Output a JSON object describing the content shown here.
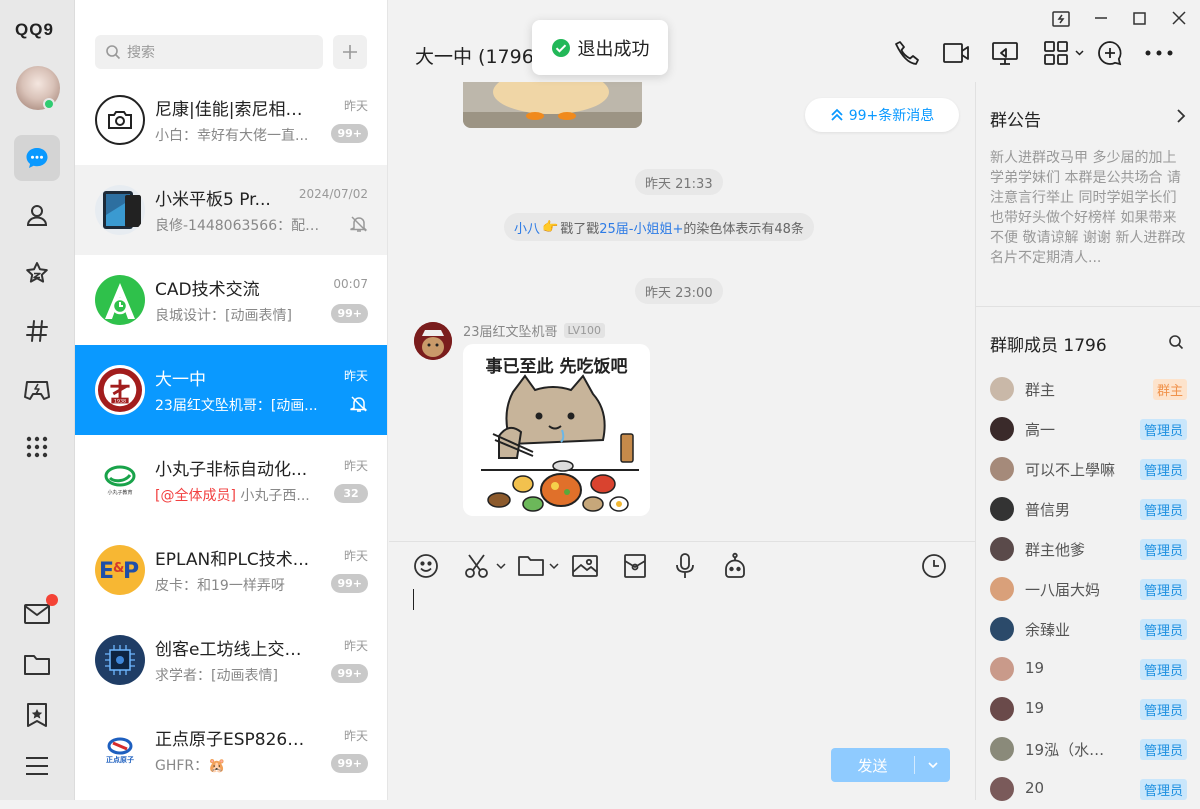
{
  "app": {
    "logo": "QQ9"
  },
  "sidebar": {
    "items": [
      {
        "name": "messages",
        "active": true
      },
      {
        "name": "contacts"
      },
      {
        "name": "zone"
      },
      {
        "name": "channels"
      },
      {
        "name": "games"
      },
      {
        "name": "apps"
      }
    ],
    "bottom": [
      "mail",
      "folder",
      "favorites",
      "menu"
    ]
  },
  "search": {
    "placeholder": "搜索"
  },
  "conversations": [
    {
      "name": "尼康|佳能|索尼相机...",
      "time": "昨天",
      "preview": "小白：幸好有大佬一直...",
      "badge": "99+"
    },
    {
      "name": "小米平板5 Pr...",
      "time": "2024/07/02",
      "preview": "良修-1448063566：配置...",
      "muted": true
    },
    {
      "name": "CAD技术交流",
      "time": "00:07",
      "preview": "良城设计：[动画表情]",
      "badge": "99+"
    },
    {
      "name": "大一中",
      "time": "昨天",
      "preview": "23届红文坠机哥：[动画...",
      "muted": true,
      "selected": true
    },
    {
      "name": "小丸子非标自动化...",
      "time": "昨天",
      "mention": "[@全体成员]",
      "preview": " 小丸子西...",
      "badge": "32"
    },
    {
      "name": "EPLAN和PLC技术...",
      "time": "昨天",
      "preview": "皮卡：和19一样弄呀",
      "badge": "99+"
    },
    {
      "name": "创客e工坊线上交流...",
      "time": "昨天",
      "preview": "求学者：[动画表情]",
      "badge": "99+"
    },
    {
      "name": "正点原子ESP8266...",
      "time": "昨天",
      "preview": "GHFR：",
      "emoji": "🐹",
      "badge": "99+"
    }
  ],
  "avatar_labels": {
    "xiaowanzi": "小丸子教育",
    "zhengdian": "正点原子",
    "school_year": "1938"
  },
  "chat": {
    "title": "大一中 (1796",
    "toast": "退出成功",
    "new_messages": "99+条新消息",
    "time1": "昨天 21:33",
    "system": {
      "actor": "小八",
      "verb": "戳了戳",
      "target": "25届-小姐姐+",
      "tail": "的染色体表示有48条"
    },
    "time2": "昨天 23:00",
    "message": {
      "sender": "23届红文坠机哥",
      "level": "LV100",
      "sticker_caption": "事已至此 先吃饭吧"
    },
    "send_label": "发送"
  },
  "panel": {
    "announcement_title": "群公告",
    "announcement_text": "新人进群改马甲 多少届的加上 学弟学妹们 本群是公共场合 请注意言行举止 同时学姐学长们也带好头做个好榜样 如果带来不便 敬请谅解 谢谢 新人进群改名片不定期清人...",
    "members_title": "群聊成员 1796",
    "members": [
      {
        "name": "群主",
        "tag": "群主",
        "role": "owner",
        "color": "#c9b8a8"
      },
      {
        "name": "高一",
        "tag": "管理员",
        "role": "admin",
        "color": "#3a2a2a"
      },
      {
        "name": "可以不上學嘛",
        "tag": "管理员",
        "role": "admin",
        "color": "#a58a7a"
      },
      {
        "name": "普信男",
        "tag": "管理员",
        "role": "admin",
        "color": "#333333"
      },
      {
        "name": "群主他爹",
        "tag": "管理员",
        "role": "admin",
        "color": "#5a4a4a"
      },
      {
        "name": "一八届大妈",
        "tag": "管理员",
        "role": "admin",
        "color": "#d9a07a"
      },
      {
        "name": "余臻业",
        "tag": "管理员",
        "role": "admin",
        "color": "#2b4a6a"
      },
      {
        "name": "19",
        "tag": "管理员",
        "role": "admin",
        "color": "#c99a8a"
      },
      {
        "name": "19",
        "tag": "管理员",
        "role": "admin",
        "color": "#6a4a4a"
      },
      {
        "name": "19泓（水泥...",
        "tag": "管理员",
        "role": "admin",
        "color": "#8a8a7a"
      },
      {
        "name": "20",
        "tag": "管理员",
        "role": "admin",
        "color": "#7a5a5a"
      }
    ]
  },
  "colors": {
    "accent": "#0a99ff",
    "badge": "#c9c9c9",
    "online": "#2fcc71",
    "mention": "#f24040"
  }
}
